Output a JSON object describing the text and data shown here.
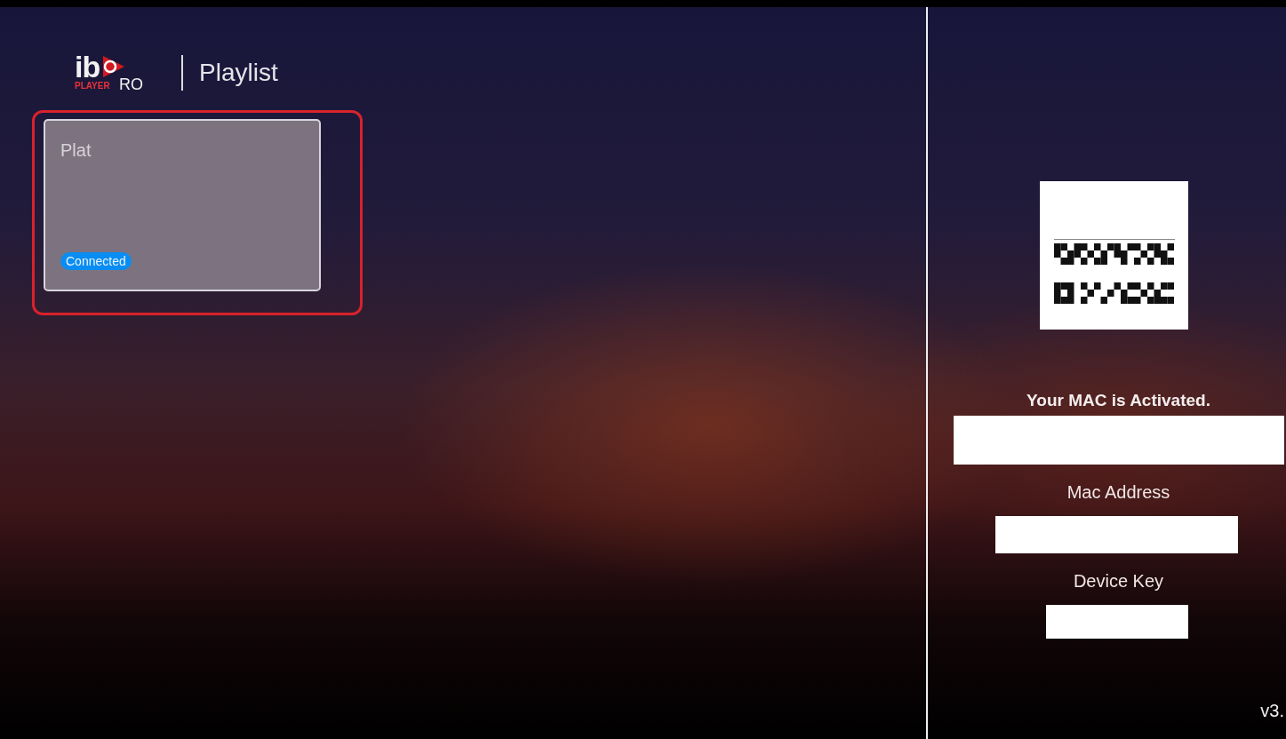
{
  "header": {
    "logo": {
      "text": "ib",
      "suffix": "RO",
      "tagline": "PLAYER"
    },
    "title": "Playlist"
  },
  "playlists": [
    {
      "name": "Plat",
      "status": "Connected",
      "selected": true
    }
  ],
  "activation": {
    "message": "Your MAC is Activated.",
    "fields": [
      {
        "label": "Mac Address"
      },
      {
        "label": "Device Key"
      }
    ]
  },
  "version": "v3."
}
